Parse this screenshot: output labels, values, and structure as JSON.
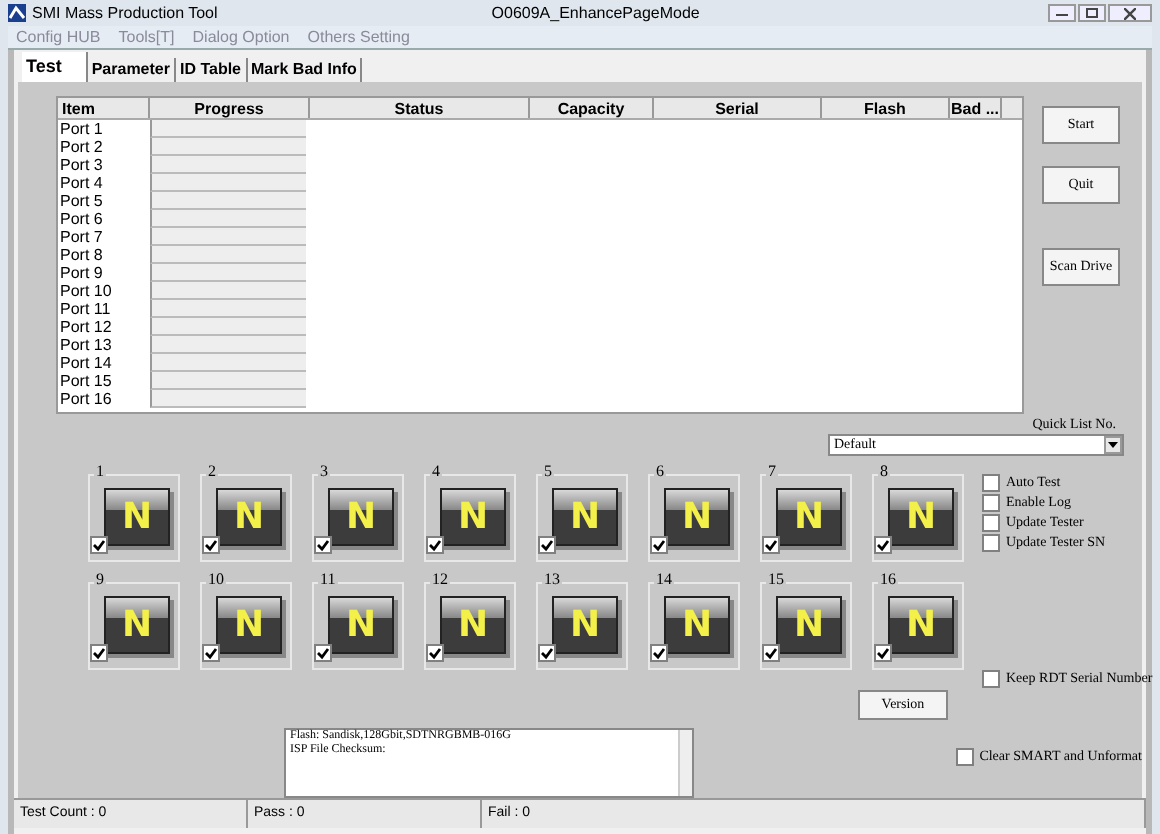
{
  "window": {
    "title": "SMI Mass Production Tool",
    "subtitle": "O0609A_EnhancePageMode"
  },
  "menu": [
    "Config HUB",
    "Tools[T]",
    "Dialog Option",
    "Others Setting"
  ],
  "tabs": [
    {
      "label": "Test",
      "selected": true
    },
    {
      "label": "Parameter",
      "selected": false
    },
    {
      "label": "ID Table",
      "selected": false
    },
    {
      "label": "Mark Bad Info",
      "selected": false
    }
  ],
  "table": {
    "columns": [
      "Item",
      "Progress",
      "Status",
      "Capacity",
      "Serial",
      "Flash",
      "Bad ..."
    ],
    "rows": [
      {
        "item": "Port 1",
        "level": 0
      },
      {
        "item": "Port 2",
        "level": 0
      },
      {
        "item": "Port 3",
        "level": 0
      },
      {
        "item": "Port 4",
        "level": 0
      },
      {
        "item": "Port 5",
        "level": 0
      },
      {
        "item": "Port 6",
        "level": 0
      },
      {
        "item": "Port 7",
        "level": 0
      },
      {
        "item": "Port 8",
        "level": 0
      },
      {
        "item": "Port 9",
        "level": 0
      },
      {
        "item": "Port 10",
        "level": 0
      },
      {
        "item": "Port 11",
        "level": 0
      },
      {
        "item": "Port 12",
        "level": 0
      },
      {
        "item": "Port 13",
        "level": 0
      },
      {
        "item": "Port 14",
        "level": 0
      },
      {
        "item": "Port 15",
        "level": 0
      },
      {
        "item": "Port 16",
        "level": 0
      }
    ]
  },
  "buttons": [
    "Start",
    "Quit",
    "Scan Drive"
  ],
  "quick_list": {
    "label": "Quick List No.",
    "value": "Default"
  },
  "ports": [
    {
      "number": "1",
      "status": "N",
      "checked": true
    },
    {
      "number": "2",
      "status": "N",
      "checked": true
    },
    {
      "number": "3",
      "status": "N",
      "checked": true
    },
    {
      "number": "4",
      "status": "N",
      "checked": true
    },
    {
      "number": "5",
      "status": "N",
      "checked": true
    },
    {
      "number": "6",
      "status": "N",
      "checked": true
    },
    {
      "number": "7",
      "status": "N",
      "checked": true
    },
    {
      "number": "8",
      "status": "N",
      "checked": true
    },
    {
      "number": "9",
      "status": "N",
      "checked": true
    },
    {
      "number": "10",
      "status": "N",
      "checked": true
    },
    {
      "number": "11",
      "status": "N",
      "checked": true
    },
    {
      "number": "12",
      "status": "N",
      "checked": true
    },
    {
      "number": "13",
      "status": "N",
      "checked": true
    },
    {
      "number": "14",
      "status": "N",
      "checked": true
    },
    {
      "number": "15",
      "status": "N",
      "checked": true
    },
    {
      "number": "16",
      "status": "N",
      "checked": true
    }
  ],
  "options": [
    {
      "label": "Auto Test",
      "checked": false
    },
    {
      "label": "Enable Log",
      "checked": false
    },
    {
      "label": "Update Tester",
      "checked": false
    },
    {
      "label": "Update Tester SN",
      "checked": false
    }
  ],
  "version_button": "Version",
  "keep_rdt": {
    "label": "Keep RDT Serial Number",
    "checked": false
  },
  "log": [
    "Flash: Sandisk,128Gbit,SDTNRGBMB-016G",
    "ISP File Checksum:"
  ],
  "clear_smart": {
    "label": "Clear SMART and Unformat",
    "checked": false
  },
  "status_bar": [
    "Test Count : 0",
    "Pass : 0",
    "Fail : 0"
  ]
}
